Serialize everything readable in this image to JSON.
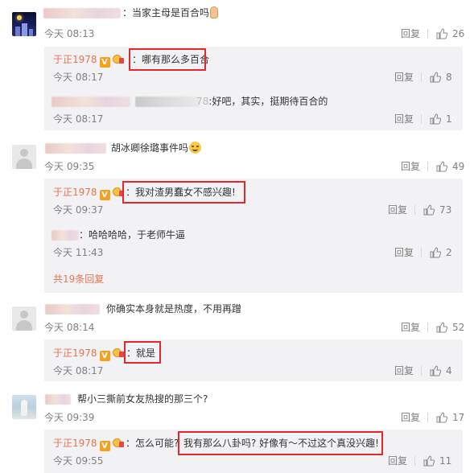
{
  "comments": [
    {
      "text": "：当家主母是百合吗",
      "time": "今天 08:13",
      "reply_label": "回复",
      "likes": "26",
      "replies": [
        {
          "user": "于正1978",
          "text": "：哪有那么多百合",
          "time": "今天 08:17",
          "reply_label": "回复",
          "likes": "8"
        },
        {
          "user_suffix": "78",
          "text": ":好吧，其实，挺期待百合的",
          "time": "今天 08:17",
          "reply_label": "回复",
          "likes": "1"
        }
      ]
    },
    {
      "text": "胡冰卿徐璐事件吗",
      "time": "今天 09:35",
      "reply_label": "回复",
      "likes": "49",
      "replies": [
        {
          "user": "于正1978",
          "text": "：我对渣男蠢女不感兴趣!",
          "time": "今天 09:37",
          "reply_label": "回复",
          "likes": "73"
        },
        {
          "text": "：哈哈哈哈，于老师牛逼",
          "time": "今天 11:43",
          "reply_label": "回复",
          "likes": "2"
        }
      ],
      "more_replies": "共19条回复"
    },
    {
      "text": "你确实本身就是热度，不用再蹭",
      "time": "今天 08:14",
      "reply_label": "回复",
      "likes": "52",
      "replies": [
        {
          "user": "于正1978",
          "text": "：就是",
          "time": "今天 08:17",
          "reply_label": "回复",
          "likes": "4"
        }
      ]
    },
    {
      "text": "帮小三撕前女友热搜的那三个?",
      "time": "今天 09:39",
      "reply_label": "回复",
      "likes": "17",
      "replies": [
        {
          "user": "于正1978",
          "text_pre": "：怎么可能?",
          "text_hl": "我有那么八卦吗? 好像有～不过这个真没兴趣!",
          "time": "今天 09:55",
          "reply_label": "回复",
          "likes": "11"
        }
      ]
    }
  ],
  "badge_v": "V",
  "colors": {
    "username": "#eb7350",
    "highlight_border": "#e3282b",
    "subpanel_bg": "#f2f2f5",
    "muted": "#808080"
  }
}
